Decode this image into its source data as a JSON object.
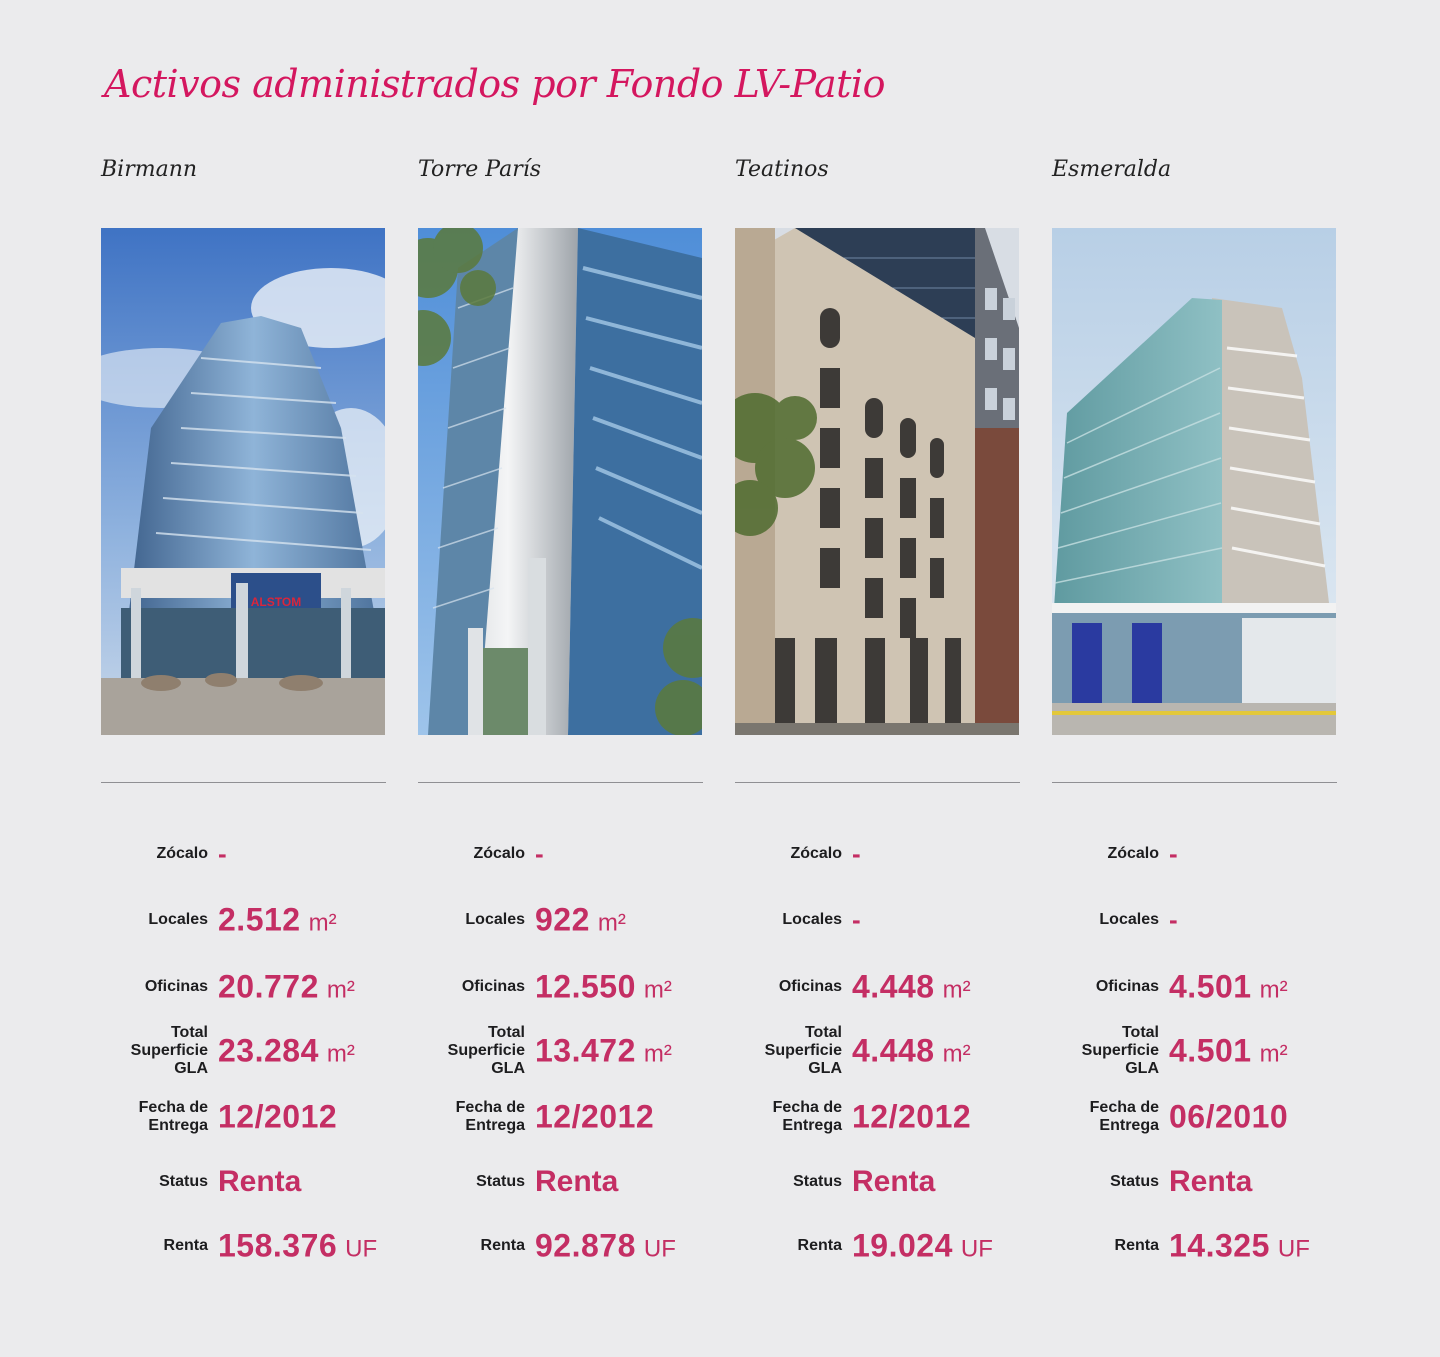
{
  "title": "Activos administrados por Fondo LV-Patio",
  "labels": {
    "zocalo": "Zócalo",
    "locales": "Locales",
    "oficinas": "Oficinas",
    "total": "Total\nSuperficie\nGLA",
    "fecha": "Fecha de\nEntrega",
    "status": "Status",
    "renta": "Renta"
  },
  "units": {
    "area": "m²",
    "currency": "UF"
  },
  "assets": [
    {
      "name": "Birmann",
      "zocalo": "-",
      "locales": "2.512",
      "oficinas": "20.772",
      "total": "23.284",
      "fecha": "12/2012",
      "status": "Renta",
      "renta": "158.376"
    },
    {
      "name": "Torre París",
      "zocalo": "-",
      "locales": "922",
      "oficinas": "12.550",
      "total": "13.472",
      "fecha": "12/2012",
      "status": "Renta",
      "renta": "92.878"
    },
    {
      "name": "Teatinos",
      "zocalo": "-",
      "locales": "-",
      "oficinas": "4.448",
      "total": "4.448",
      "fecha": "12/2012",
      "status": "Renta",
      "renta": "19.024"
    },
    {
      "name": "Esmeralda",
      "zocalo": "-",
      "locales": "-",
      "oficinas": "4.501",
      "total": "4.501",
      "fecha": "06/2010",
      "status": "Renta",
      "renta": "14.325"
    }
  ],
  "colors": {
    "accent": "#d4175f",
    "value": "#c42e64",
    "background": "#ebebed"
  }
}
